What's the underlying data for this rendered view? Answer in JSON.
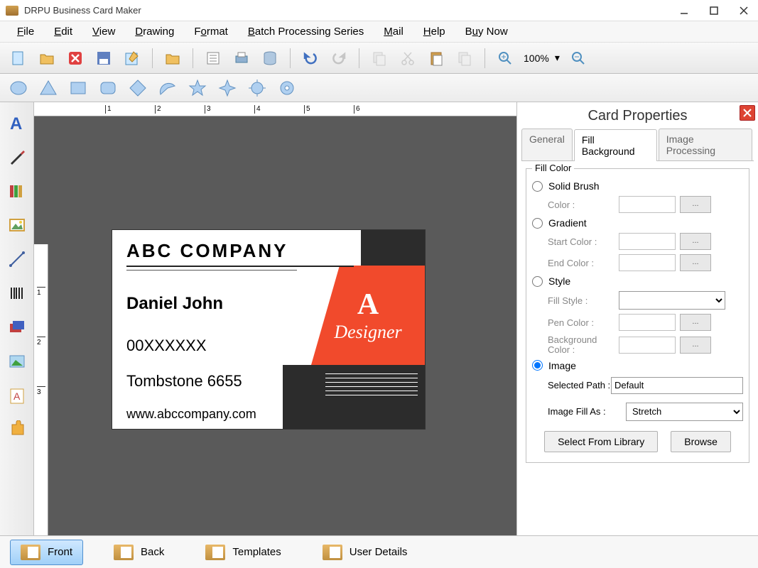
{
  "title": "DRPU Business Card Maker",
  "menu": [
    "File",
    "Edit",
    "View",
    "Drawing",
    "Format",
    "Batch Processing Series",
    "Mail",
    "Help",
    "Buy Now"
  ],
  "zoom": "100%",
  "card": {
    "company": "ABC COMPANY",
    "name": "Daniel John",
    "phone": "00XXXXXX",
    "address": "Tombstone 6655",
    "website": "www.abccompany.com",
    "logo_letter": "A",
    "designer": "Designer"
  },
  "props": {
    "title": "Card Properties",
    "tabs": [
      "General",
      "Fill Background",
      "Image Processing"
    ],
    "active_tab": 1,
    "fill_legend": "Fill Color",
    "solid": "Solid Brush",
    "color_label": "Color :",
    "gradient": "Gradient",
    "start_color": "Start Color :",
    "end_color": "End Color :",
    "style": "Style",
    "fill_style": "Fill Style :",
    "pen_color": "Pen Color :",
    "bg_color": "Background Color :",
    "image": "Image",
    "selected_path_label": "Selected Path :",
    "selected_path": "Default",
    "image_fill_label": "Image Fill As :",
    "image_fill": "Stretch",
    "select_lib": "Select From Library",
    "browse": "Browse"
  },
  "bottom": [
    "Front",
    "Back",
    "Templates",
    "User Details"
  ]
}
